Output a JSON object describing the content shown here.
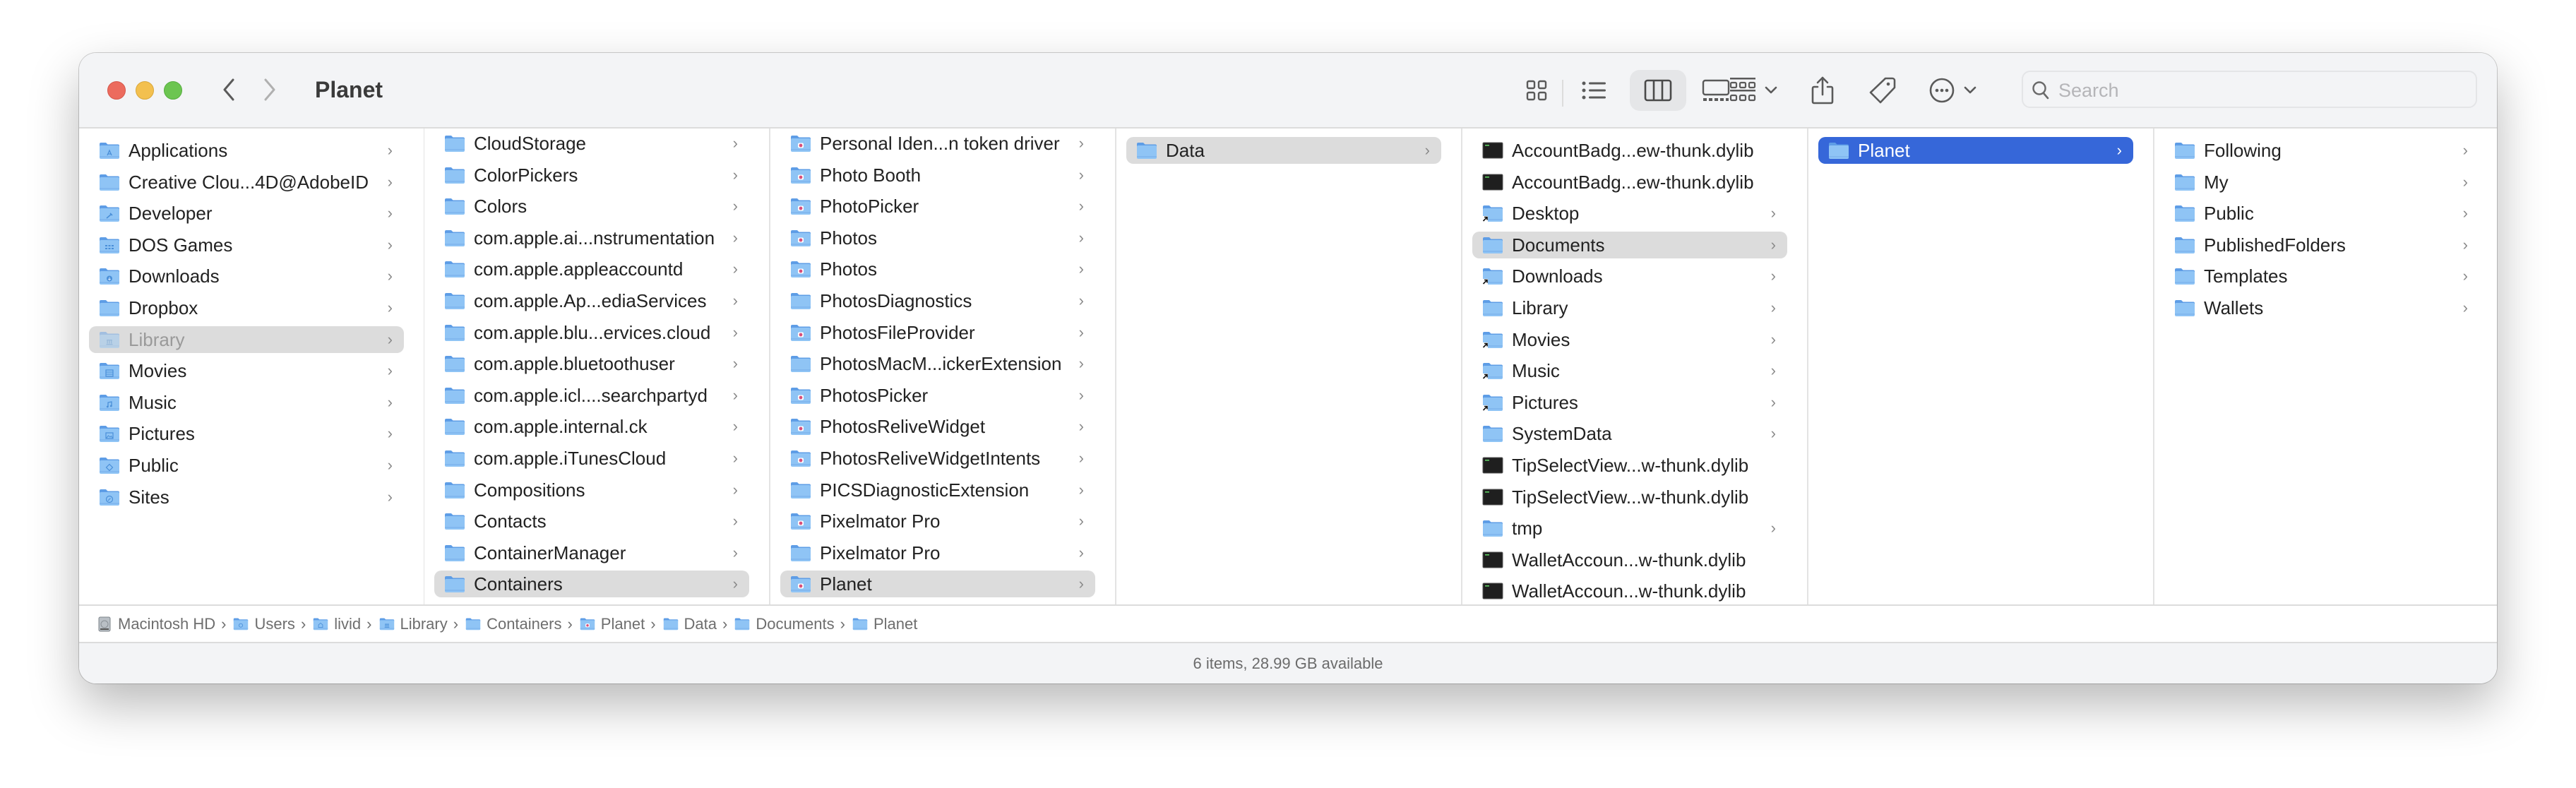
{
  "window": {
    "title": "Planet"
  },
  "toolbar": {
    "back_label": "Back",
    "forward_label": "Forward",
    "view_modes": [
      "icon-view",
      "list-view",
      "column-view",
      "gallery-view"
    ],
    "selected_view": "column-view",
    "group_label": "Group",
    "share_label": "Share",
    "tags_label": "Tags",
    "more_label": "More actions",
    "search_placeholder": "Search",
    "search_value": ""
  },
  "colors": {
    "selection_active": "#3667d9",
    "selection_inactive": "#dcdcdc",
    "folder_blue": "#7cb8f0",
    "close": "#ec6b5e",
    "minimize": "#f3c04f",
    "maximize": "#6cc551"
  },
  "columns": [
    {
      "name": "home",
      "items": [
        {
          "label": "Applications",
          "icon": "applications-folder-icon",
          "chevron": true
        },
        {
          "label": "Creative Clou...4D@AdobeID",
          "icon": "folder-icon",
          "chevron": true
        },
        {
          "label": "Developer",
          "icon": "developer-folder-icon",
          "chevron": true
        },
        {
          "label": "DOS Games",
          "icon": "games-folder-icon",
          "chevron": true
        },
        {
          "label": "Downloads",
          "icon": "downloads-folder-icon",
          "chevron": true
        },
        {
          "label": "Dropbox",
          "icon": "folder-icon",
          "chevron": true
        },
        {
          "label": "Library",
          "icon": "library-folder-icon",
          "chevron": true,
          "state": "selected-dim"
        },
        {
          "label": "Movies",
          "icon": "movies-folder-icon",
          "chevron": true
        },
        {
          "label": "Music",
          "icon": "music-folder-icon",
          "chevron": true
        },
        {
          "label": "Pictures",
          "icon": "pictures-folder-icon",
          "chevron": true
        },
        {
          "label": "Public",
          "icon": "public-folder-icon",
          "chevron": true
        },
        {
          "label": "Sites",
          "icon": "sites-folder-icon",
          "chevron": true
        }
      ]
    },
    {
      "name": "library",
      "items": [
        {
          "label": "CloudStorage",
          "icon": "folder-icon",
          "chevron": true
        },
        {
          "label": "ColorPickers",
          "icon": "folder-icon",
          "chevron": true
        },
        {
          "label": "Colors",
          "icon": "folder-icon",
          "chevron": true
        },
        {
          "label": "com.apple.ai...nstrumentation",
          "icon": "folder-icon",
          "chevron": true
        },
        {
          "label": "com.apple.appleaccountd",
          "icon": "folder-icon",
          "chevron": true
        },
        {
          "label": "com.apple.Ap...ediaServices",
          "icon": "folder-icon",
          "chevron": true
        },
        {
          "label": "com.apple.blu...ervices.cloud",
          "icon": "folder-icon",
          "chevron": true
        },
        {
          "label": "com.apple.bluetoothuser",
          "icon": "folder-icon",
          "chevron": true
        },
        {
          "label": "com.apple.icl....searchpartyd",
          "icon": "folder-icon",
          "chevron": true
        },
        {
          "label": "com.apple.internal.ck",
          "icon": "folder-icon",
          "chevron": true
        },
        {
          "label": "com.apple.iTunesCloud",
          "icon": "folder-icon",
          "chevron": true
        },
        {
          "label": "Compositions",
          "icon": "folder-icon",
          "chevron": true
        },
        {
          "label": "Contacts",
          "icon": "folder-icon",
          "chevron": true
        },
        {
          "label": "ContainerManager",
          "icon": "folder-icon",
          "chevron": true
        },
        {
          "label": "Containers",
          "icon": "folder-icon",
          "chevron": true,
          "state": "selected"
        }
      ]
    },
    {
      "name": "containers",
      "items": [
        {
          "label": "Personal Iden...n token driver",
          "icon": "app-container-folder-icon",
          "chevron": true
        },
        {
          "label": "Photo Booth",
          "icon": "app-container-folder-icon",
          "chevron": true
        },
        {
          "label": "PhotoPicker",
          "icon": "app-container-folder-icon",
          "chevron": true
        },
        {
          "label": "Photos",
          "icon": "app-container-folder-icon",
          "chevron": true
        },
        {
          "label": "Photos",
          "icon": "app-container-folder-icon",
          "chevron": true
        },
        {
          "label": "PhotosDiagnostics",
          "icon": "folder-icon",
          "chevron": true
        },
        {
          "label": "PhotosFileProvider",
          "icon": "app-container-folder-icon",
          "chevron": true
        },
        {
          "label": "PhotosMacM...ickerExtension",
          "icon": "folder-icon",
          "chevron": true
        },
        {
          "label": "PhotosPicker",
          "icon": "app-container-folder-icon",
          "chevron": true
        },
        {
          "label": "PhotosReliveWidget",
          "icon": "app-container-folder-icon",
          "chevron": true
        },
        {
          "label": "PhotosReliveWidgetIntents",
          "icon": "app-container-folder-icon",
          "chevron": true
        },
        {
          "label": "PICSDiagnosticExtension",
          "icon": "folder-icon",
          "chevron": true
        },
        {
          "label": "Pixelmator Pro",
          "icon": "app-container-folder-icon",
          "chevron": true
        },
        {
          "label": "Pixelmator Pro",
          "icon": "folder-icon",
          "chevron": true
        },
        {
          "label": "Planet",
          "icon": "app-container-folder-icon",
          "chevron": true,
          "state": "selected"
        }
      ]
    },
    {
      "name": "planet-container",
      "items": [
        {
          "label": "Data",
          "icon": "folder-icon",
          "chevron": true,
          "state": "selected"
        }
      ]
    },
    {
      "name": "data",
      "items": [
        {
          "label": "AccountBadg...ew-thunk.dylib",
          "icon": "executable-file-icon",
          "chevron": false
        },
        {
          "label": "AccountBadg...ew-thunk.dylib",
          "icon": "executable-file-icon",
          "chevron": false
        },
        {
          "label": "Desktop",
          "icon": "alias-folder-icon",
          "chevron": true
        },
        {
          "label": "Documents",
          "icon": "folder-icon",
          "chevron": true,
          "state": "selected"
        },
        {
          "label": "Downloads",
          "icon": "alias-folder-icon",
          "chevron": true
        },
        {
          "label": "Library",
          "icon": "folder-icon",
          "chevron": true
        },
        {
          "label": "Movies",
          "icon": "alias-folder-icon",
          "chevron": true
        },
        {
          "label": "Music",
          "icon": "alias-folder-icon",
          "chevron": true
        },
        {
          "label": "Pictures",
          "icon": "alias-folder-icon",
          "chevron": true
        },
        {
          "label": "SystemData",
          "icon": "folder-icon",
          "chevron": true
        },
        {
          "label": "TipSelectView...w-thunk.dylib",
          "icon": "executable-file-icon",
          "chevron": false
        },
        {
          "label": "TipSelectView...w-thunk.dylib",
          "icon": "executable-file-icon",
          "chevron": false
        },
        {
          "label": "tmp",
          "icon": "folder-icon",
          "chevron": true
        },
        {
          "label": "WalletAccoun...w-thunk.dylib",
          "icon": "executable-file-icon",
          "chevron": false
        },
        {
          "label": "WalletAccoun...w-thunk.dylib",
          "icon": "executable-file-icon",
          "chevron": false
        }
      ]
    },
    {
      "name": "documents",
      "items": [
        {
          "label": "Planet",
          "icon": "folder-icon",
          "chevron": true,
          "state": "selected-active"
        }
      ]
    },
    {
      "name": "planet",
      "items": [
        {
          "label": "Following",
          "icon": "folder-icon",
          "chevron": true
        },
        {
          "label": "My",
          "icon": "folder-icon",
          "chevron": true
        },
        {
          "label": "Public",
          "icon": "folder-icon",
          "chevron": true
        },
        {
          "label": "PublishedFolders",
          "icon": "folder-icon",
          "chevron": true
        },
        {
          "label": "Templates",
          "icon": "folder-icon",
          "chevron": true
        },
        {
          "label": "Wallets",
          "icon": "folder-icon",
          "chevron": true
        }
      ]
    }
  ],
  "path_bar": [
    {
      "label": "Macintosh HD",
      "icon": "hard-drive-icon"
    },
    {
      "label": "Users",
      "icon": "users-folder-icon"
    },
    {
      "label": "livid",
      "icon": "home-folder-icon"
    },
    {
      "label": "Library",
      "icon": "library-folder-icon"
    },
    {
      "label": "Containers",
      "icon": "folder-icon"
    },
    {
      "label": "Planet",
      "icon": "app-container-folder-icon"
    },
    {
      "label": "Data",
      "icon": "folder-icon"
    },
    {
      "label": "Documents",
      "icon": "folder-icon"
    },
    {
      "label": "Planet",
      "icon": "folder-icon"
    }
  ],
  "status_bar": {
    "text": "6 items, 28.99 GB available"
  }
}
